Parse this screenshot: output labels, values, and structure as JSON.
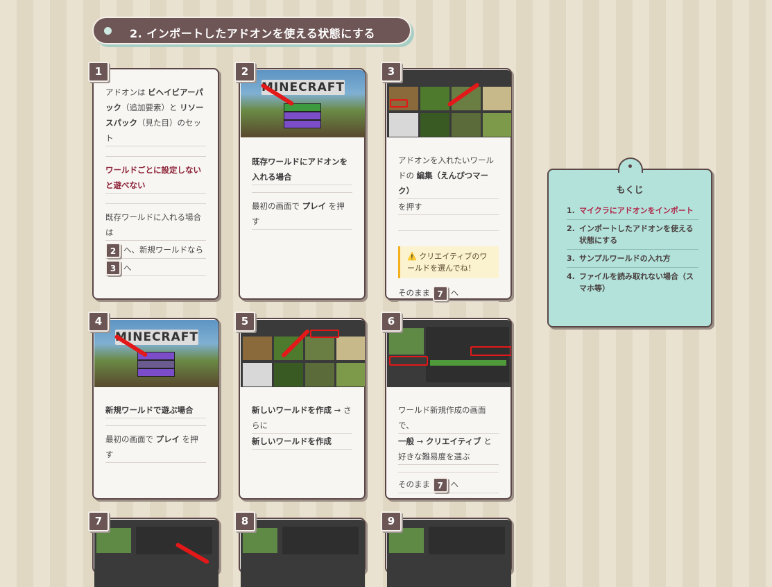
{
  "section": {
    "title": "2. インポートしたアドオンを使える状態にする"
  },
  "cards": [
    {
      "num": "1",
      "lines": [
        {
          "segs": [
            {
              "t": "アドオンは "
            },
            {
              "t": "ビヘイビアーパック",
              "b": true
            },
            {
              "t": "（追加要素）と "
            },
            {
              "t": "リソースパック",
              "b": true
            },
            {
              "t": "（見た目）のセット"
            }
          ]
        },
        {
          "warn": "ワールドごとに設定しないと遊べない"
        },
        {
          "text": "既存ワールドに入れる場合は"
        },
        {
          "chip": "2",
          "after": "へ、新規ワールドなら"
        },
        {
          "chip": "3",
          "after": "へ"
        }
      ]
    },
    {
      "num": "2",
      "heading": "既存ワールドにアドオンを入れる場合",
      "line": "最初の画面で ",
      "line_b": "プレイ",
      "line_end": " を押す"
    },
    {
      "num": "3",
      "text1": "アドオンを入れたいワールドの ",
      "text1_b": "編集（えんぴつマーク）",
      "text1_end": "を押す",
      "note": "クリエイティブのワールドを選んでね！",
      "tail": "そのまま",
      "tail_chip": "7",
      "tail_end": "へ"
    },
    {
      "num": "4",
      "heading": "新規ワールドで遊ぶ場合",
      "line": "最初の画面で ",
      "line_b": "プレイ",
      "line_end": " を押す",
      "logo": "MINECRAFT"
    },
    {
      "num": "5",
      "l1_b": "新しいワールドを作成",
      "l1_mid": " → さらに ",
      "l2_b": "新しいワールドを作成"
    },
    {
      "num": "6",
      "l1": "ワールド新規作成の画面で、",
      "l2_b1": "一般",
      "l2_mid": " → ",
      "l2_b2": "クリエイティブ",
      "l2_end": " と好きな難易度を選ぶ",
      "tail": "そのまま",
      "tail_chip": "7",
      "tail_end": "へ"
    },
    {
      "num": "7"
    },
    {
      "num": "8"
    },
    {
      "num": "9"
    }
  ],
  "logo": "MINECRAFT",
  "toc": {
    "title": "もくじ",
    "items": [
      {
        "n": "1.",
        "t": "マイクラにアドオンをインポート",
        "active": true
      },
      {
        "n": "2.",
        "t": "インポートしたアドオンを使える状態にする"
      },
      {
        "n": "3.",
        "t": "サンプルワールドの入れ方"
      },
      {
        "n": "4.",
        "t": "ファイルを読み取れない場合（スマホ等）"
      }
    ]
  }
}
